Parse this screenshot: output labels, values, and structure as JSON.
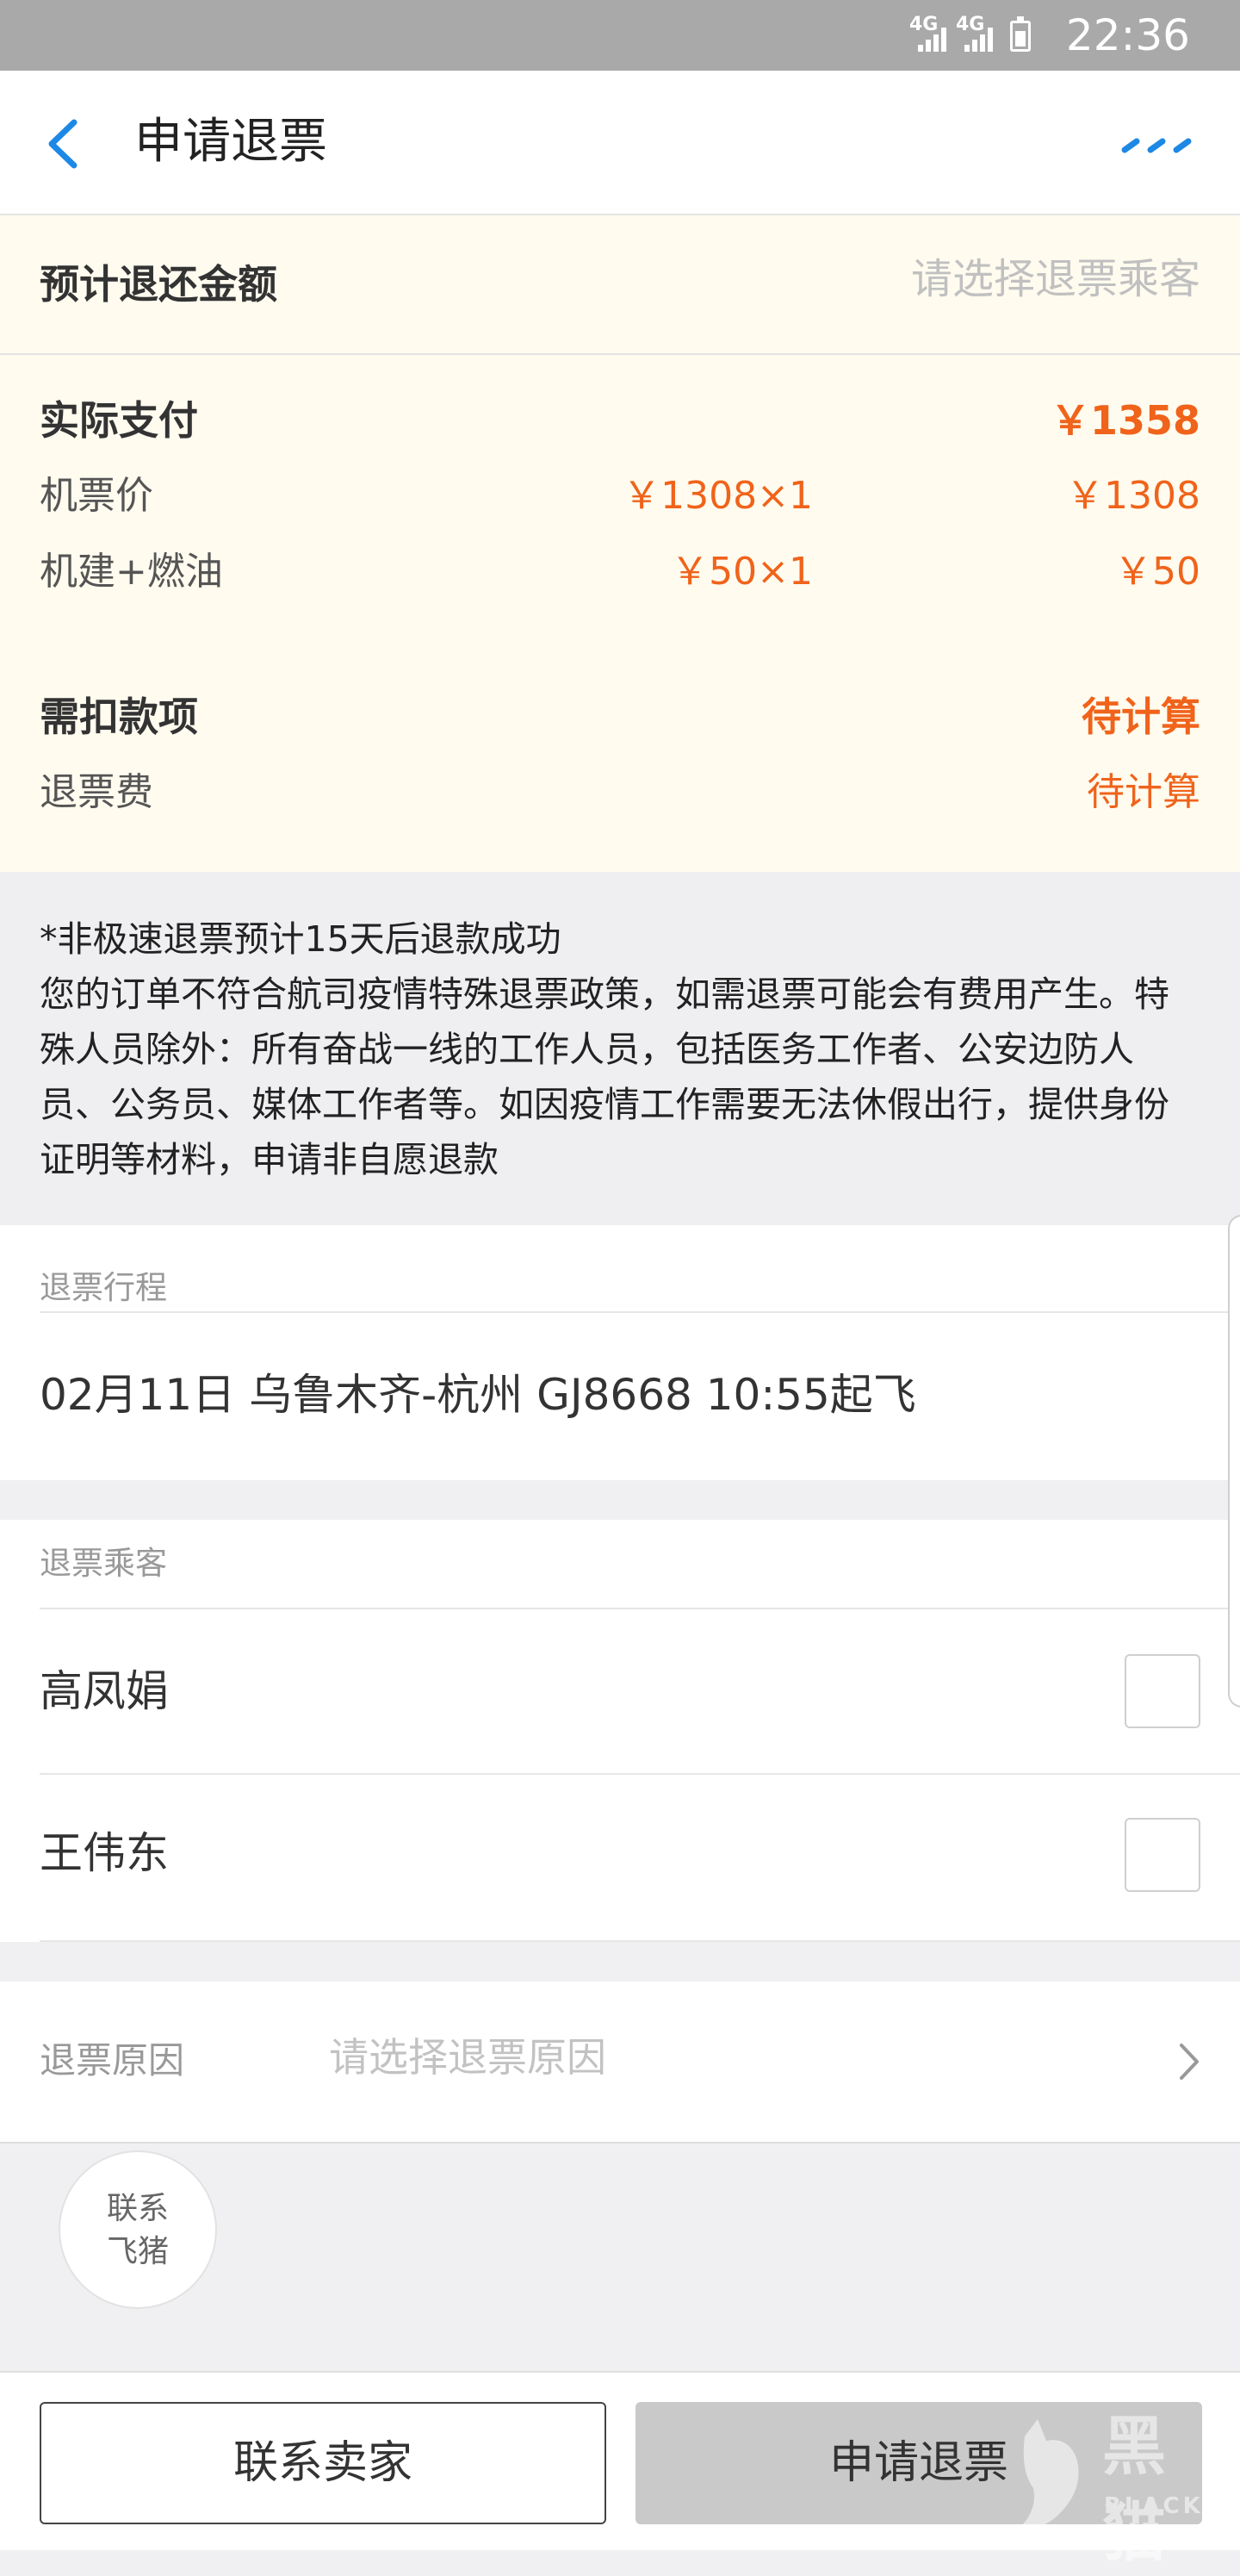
{
  "status_bar": {
    "signal_1": "4G",
    "signal_2": "4G",
    "time": "22:36"
  },
  "nav": {
    "title": "申请退票",
    "back_icon": "chevron-left-icon",
    "more_icon": "more-dots-icon",
    "accent_color": "#1e88e5"
  },
  "estimate": {
    "label": "预计退还金额",
    "placeholder": "请选择退票乘客"
  },
  "payment": {
    "header_label": "实际支付",
    "header_total": "￥1358",
    "rows": [
      {
        "label": "机票价",
        "unit": "￥1308×1",
        "total": "￥1308"
      },
      {
        "label": "机建+燃油",
        "unit": "￥50×1",
        "total": "￥50"
      }
    ]
  },
  "deductions": {
    "header_label": "需扣款项",
    "header_value": "待计算",
    "rows": [
      {
        "label": "退票费",
        "value": "待计算"
      }
    ]
  },
  "notice": {
    "line1": "*非极速退票预计15天后退款成功",
    "body": "您的订单不符合航司疫情特殊退票政策，如需退票可能会有费用产生。特殊人员除外：所有奋战一线的工作人员，包括医务工作者、公安边防人员、公务员、媒体工作者等。如因疫情工作需要无法休假出行，提供身份证明等材料，申请非自愿退款"
  },
  "itinerary": {
    "header": "退票行程",
    "trip": "02月11日 乌鲁木齐-杭州 GJ8668 10:55起飞"
  },
  "passengers": {
    "header": "退票乘客",
    "items": [
      {
        "name": "高凤娟",
        "checked": false
      },
      {
        "name": "王伟东",
        "checked": false
      }
    ]
  },
  "reason": {
    "label": "退票原因",
    "placeholder": "请选择退票原因"
  },
  "contact_fliggy": {
    "line1": "联系",
    "line2": "飞猪"
  },
  "bottom": {
    "contact_seller": "联系卖家",
    "apply_refund": "申请退票"
  },
  "watermark": {
    "cn": "黑猫",
    "en": "BLACK CAT"
  },
  "colors": {
    "orange": "#f0631a",
    "cream_bg": "#fffbef",
    "blue": "#1e88e5"
  }
}
